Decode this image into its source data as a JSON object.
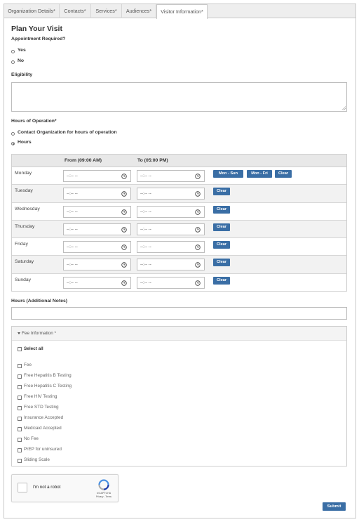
{
  "tabs": [
    {
      "label": "Organization Details*"
    },
    {
      "label": "Contacts*"
    },
    {
      "label": "Services*"
    },
    {
      "label": "Audiences*"
    },
    {
      "label": "Visitor Information*",
      "active": true
    }
  ],
  "page_title": "Plan Your Visit",
  "appointment": {
    "label": "Appointment Required?",
    "options": [
      "Yes",
      "No"
    ]
  },
  "eligibility": {
    "label": "Eligibility",
    "value": ""
  },
  "hours_of_operation": {
    "label": "Hours of Operation*",
    "options": [
      "Contact Organization for hours of operation",
      "Hours"
    ],
    "selected": "Hours"
  },
  "hours_table": {
    "from_header": "From (09:00 AM)",
    "to_header": "To (05:00 PM)",
    "time_placeholder": "--:-- --",
    "days": [
      "Monday",
      "Tuesday",
      "Wednesday",
      "Thursday",
      "Friday",
      "Saturday",
      "Sunday"
    ],
    "monday_buttons": [
      "Mon - Sun",
      "Mon - Fri",
      "Clear"
    ],
    "clear_label": "Clear"
  },
  "hours_notes": {
    "label": "Hours (Additional Notes)",
    "value": ""
  },
  "fee_information": {
    "header": "Fee Information *",
    "select_all": "Select all",
    "items": [
      "Fee",
      "Free Hepatitis B Testing",
      "Free Hepatitis C Testing",
      "Free HIV Testing",
      "Free STD Testing",
      "Insurance Accepted",
      "Medicaid Accepted",
      "No Fee",
      "PrEP for uninsured",
      "Sliding Scale"
    ]
  },
  "captcha": {
    "label": "I'm not a robot",
    "brand": "reCAPTCHA",
    "terms": "Privacy - Terms"
  },
  "submit_label": "Submit",
  "colors": {
    "accent": "#3a6ea5",
    "tab_bg": "#eeeeee",
    "row_alt": "#f2f2f2"
  }
}
